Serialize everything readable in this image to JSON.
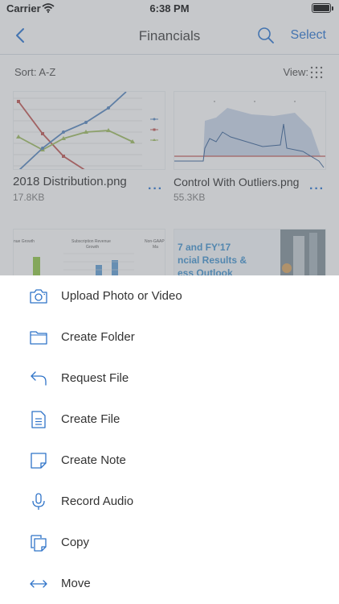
{
  "status_bar": {
    "carrier": "Carrier",
    "time": "6:38 PM"
  },
  "nav": {
    "title": "Financials",
    "select_label": "Select",
    "back_icon": "chevron-left-icon",
    "search_icon": "search-icon"
  },
  "sort_bar": {
    "sort_label": "Sort: A-Z",
    "view_label": "View:",
    "view_icon": "grid-icon"
  },
  "files": [
    {
      "name": "2018 Distribution.png",
      "size": "17.8KB",
      "more": "···"
    },
    {
      "name": "Control With Outliers.png",
      "size": "55.3KB",
      "more": "···"
    },
    {
      "name": "",
      "size": "",
      "more": ""
    },
    {
      "name": "",
      "size": "",
      "more": ""
    }
  ],
  "thumb_text": {
    "revenue_growth": "nue Growth",
    "subscription": "Subscription Revenue",
    "growth": "Growth",
    "non_gaap": "Non-GAAP",
    "ma": "Ma",
    "line1": "7 and FY'17",
    "line2": "ncial Results &",
    "line3": "ess Outlook"
  },
  "sheet": {
    "items": [
      {
        "label": "Upload Photo or Video",
        "icon": "camera-icon"
      },
      {
        "label": "Create Folder",
        "icon": "folder-icon"
      },
      {
        "label": "Request File",
        "icon": "request-file-icon"
      },
      {
        "label": "Create File",
        "icon": "file-icon"
      },
      {
        "label": "Create Note",
        "icon": "note-icon"
      },
      {
        "label": "Record Audio",
        "icon": "microphone-icon"
      },
      {
        "label": "Copy",
        "icon": "copy-icon"
      },
      {
        "label": "Move",
        "icon": "move-icon"
      }
    ]
  },
  "colors": {
    "accent": "#1f6fd0",
    "overlay": "#787c82"
  }
}
